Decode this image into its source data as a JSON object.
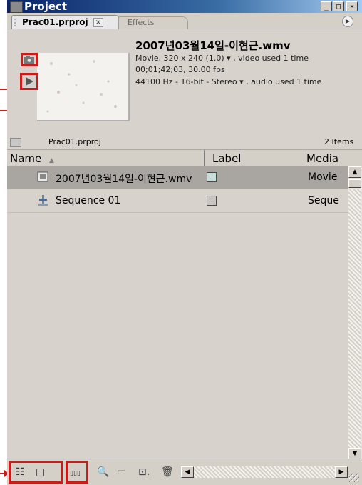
{
  "window": {
    "title": "Project",
    "min_label": "_",
    "max_label": "□",
    "close_label": "×"
  },
  "tabs": [
    {
      "label": "Prac01.prproj",
      "close": "×",
      "active": true
    },
    {
      "label": "Effects",
      "active": false
    }
  ],
  "panel_menu_icon": "play-circle-icon",
  "clip": {
    "name": "2007년03월14일-이현근.wmv",
    "line1": "Movie, 320 x 240 (1.0)  ▾ , video used 1 time",
    "line2": "00;01;42;03, 30.00 fps",
    "line3": "44100 Hz - 16-bit - Stereo  ▾ , audio used 1 time",
    "poster_frame_icon": "camera-icon",
    "play_icon": "play-triangle-icon"
  },
  "breadcrumb": {
    "folder": "Prac01.prproj",
    "count": "2 Items"
  },
  "columns": {
    "name": "Name",
    "label": "Label",
    "media": "Media"
  },
  "rows": [
    {
      "name": "2007년03월14일-이현근.wmv",
      "label_color": "#c6ddd9",
      "media": "Movie",
      "icon": "movie-icon",
      "selected": true
    },
    {
      "name": "Sequence 01",
      "label_color": "#c9c6c2",
      "media": "Seque",
      "icon": "sequence-icon",
      "selected": false
    }
  ],
  "bottom_tools": {
    "list_view": "☷",
    "icon_view": "□",
    "automate": "▯▯▯",
    "find": "🔍",
    "new_bin": "▭",
    "new_item": "⊡.",
    "clear": "🗑",
    "scroll_left": "◀",
    "scroll_right": "▶"
  },
  "scrollbar": {
    "up": "▲",
    "down": "▼"
  },
  "colors": {
    "accent_red": "#cc1b1b",
    "titlebar": "#0a246a"
  }
}
